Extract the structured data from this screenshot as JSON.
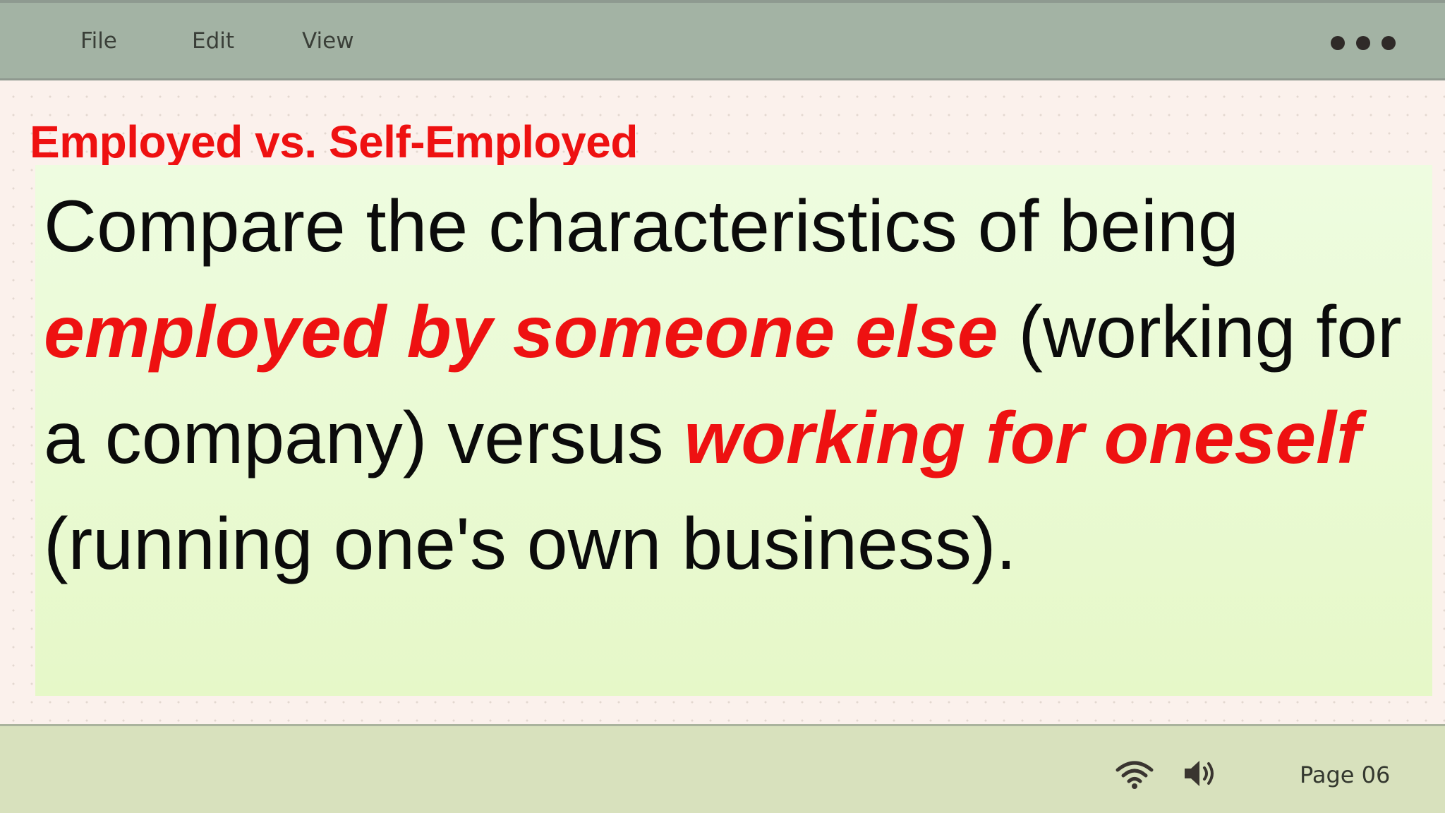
{
  "menubar": {
    "items": [
      "File",
      "Edit",
      "View"
    ]
  },
  "slide": {
    "title": "Employed vs. Self-Employed",
    "body": [
      {
        "text": "Compare the characteristics of being ",
        "emphasis": false
      },
      {
        "text": "employed by someone else",
        "emphasis": true
      },
      {
        "text": " (working for a company) versus ",
        "emphasis": false
      },
      {
        "text": "working for oneself",
        "emphasis": true
      },
      {
        "text": " (running one's own business).",
        "emphasis": false
      }
    ]
  },
  "statusbar": {
    "page_label": "Page 06",
    "icons": [
      "wifi-icon",
      "volume-icon"
    ]
  },
  "colors": {
    "accent": "#ee1111",
    "menubar_bg": "#a3b3a4",
    "statusbar_bg": "#d8e1bd",
    "body_box_bg": "#eafbd4",
    "page_bg": "#fbf1ec"
  }
}
